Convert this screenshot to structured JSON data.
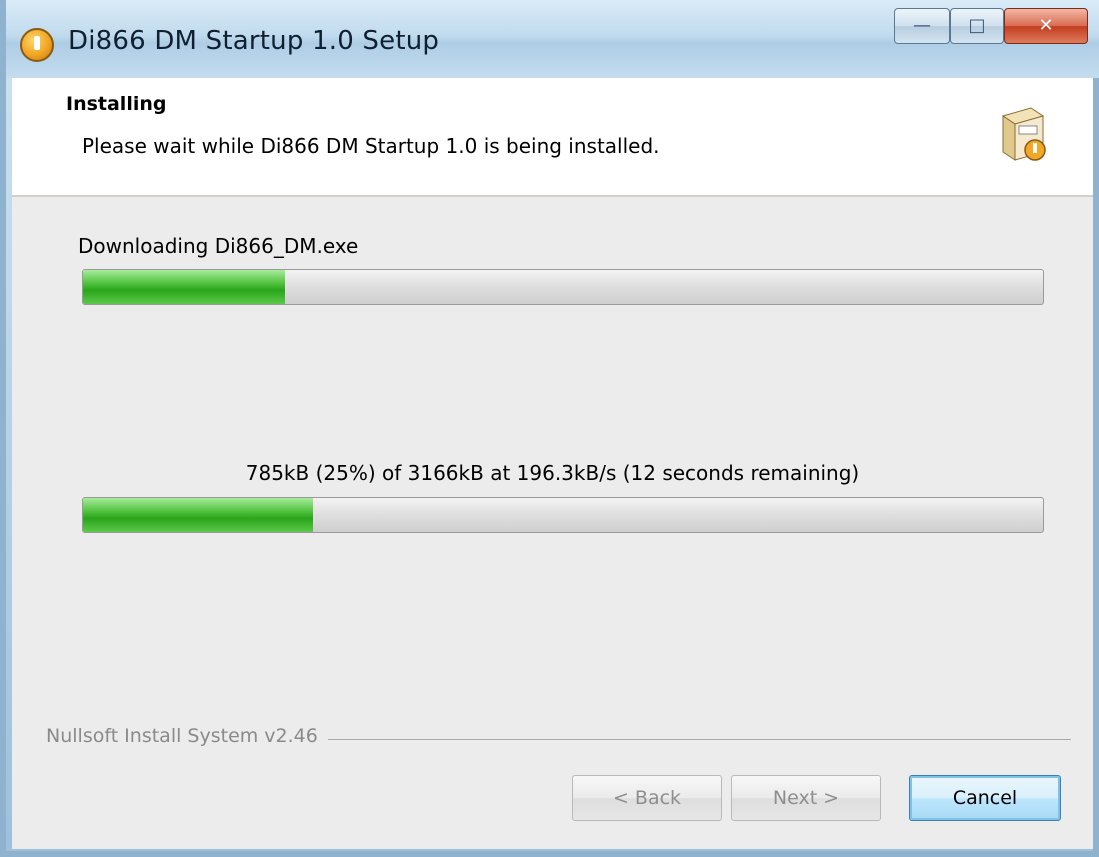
{
  "window": {
    "title": "Di866 DM Startup 1.0 Setup",
    "controls": {
      "minimize_icon": "minimize-icon",
      "maximize_icon": "maximize-icon",
      "close_icon": "close-icon"
    }
  },
  "header": {
    "title": "Installing",
    "subtitle": "Please wait while Di866 DM Startup 1.0 is being installed.",
    "icon": "installer-box-icon"
  },
  "content": {
    "download_label": "Downloading Di866_DM.exe",
    "progress_primary_fraction": 0.21,
    "status_text": "785kB (25%) of 3166kB at 196.3kB/s (12 seconds remaining)",
    "progress_secondary_fraction": 0.24
  },
  "footer": {
    "branding": "Nullsoft Install System v2.46",
    "back_label": "< Back",
    "next_label": "Next >",
    "cancel_label": "Cancel"
  },
  "colors": {
    "progress_fill": "#3fb52d",
    "accent_button": "#3c7fb1"
  }
}
